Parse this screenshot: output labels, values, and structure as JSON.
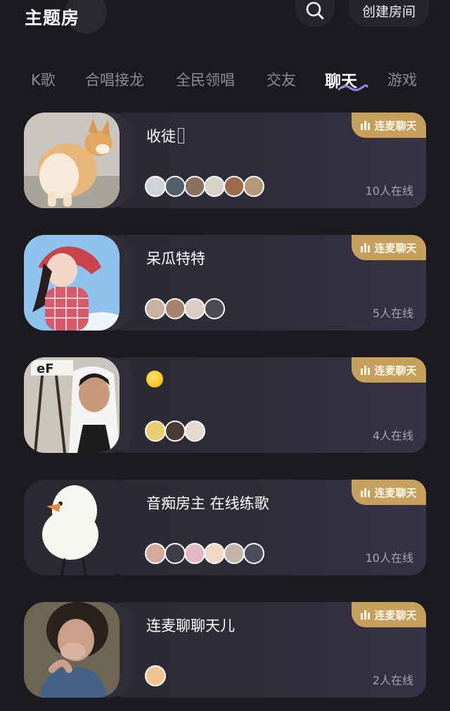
{
  "header": {
    "title": "主题房",
    "create_label": "创建房间"
  },
  "tabs": [
    {
      "label": "K歌"
    },
    {
      "label": "合唱接龙"
    },
    {
      "label": "全民领唱"
    },
    {
      "label": "交友"
    },
    {
      "label": "聊天",
      "active": true
    },
    {
      "label": "游戏"
    }
  ],
  "badge_label": "连麦聊天",
  "rooms": [
    {
      "name": "收徒",
      "online": "10人在线",
      "thumb": "corgi-photo",
      "avatar_count": 6
    },
    {
      "name": "呆瓜特特",
      "online": "5人在线",
      "thumb": "girl-red-scarf-photo",
      "avatar_count": 4
    },
    {
      "name": "",
      "online": "4人在线",
      "thumb": "man-white-hoodie-photo",
      "avatar_count": 3,
      "name_icon": "yellow-emoji"
    },
    {
      "name": "音痴房主 在线练歌",
      "online": "10人在线",
      "thumb": "duck-cartoon",
      "avatar_count": 6
    },
    {
      "name": "连麦聊聊天儿",
      "online": "2人在线",
      "thumb": "woman-laughing-photo",
      "avatar_count": 1
    }
  ],
  "colors": {
    "background": "#1b1a1f",
    "badge": "#c7a05d",
    "tab_active": "#ffffff",
    "tab_inactive": "#8d8a94",
    "tab_underline": "#8e86e8"
  }
}
